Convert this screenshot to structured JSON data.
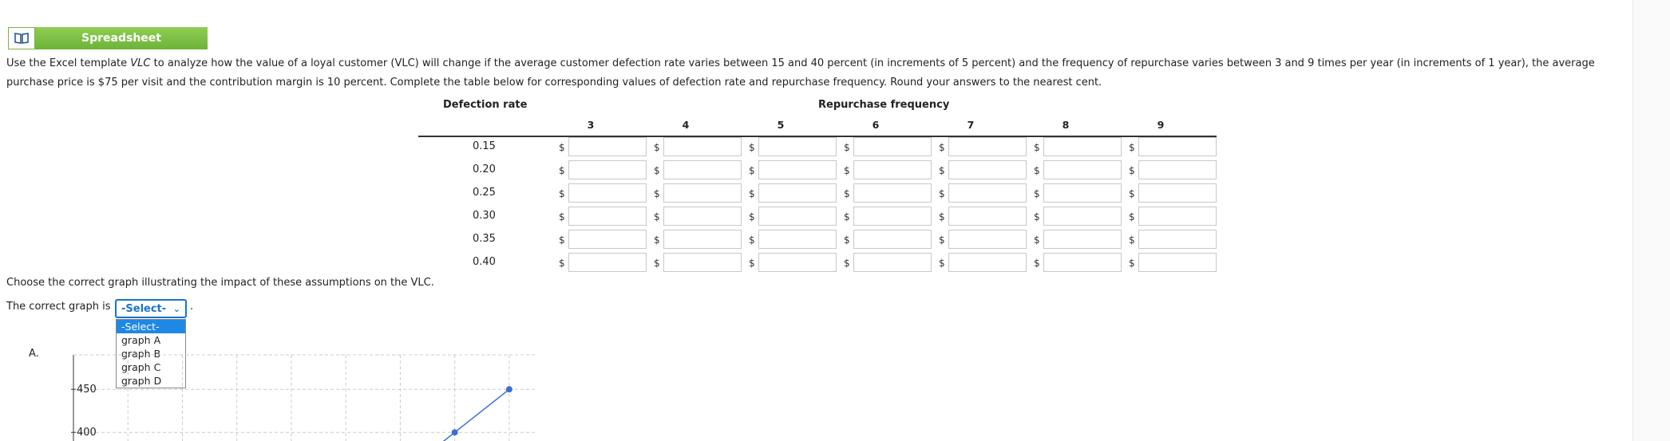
{
  "spreadsheet_button": {
    "label": "Spreadsheet",
    "icon": "book-icon"
  },
  "instructions": {
    "part1": "Use the Excel template ",
    "template_name": "VLC",
    "part2": " to analyze how the value of a loyal customer (VLC) will change if the average customer defection rate varies between 15 and 40 percent (in increments of 5 percent) and the frequency of repurchase varies between 3 and 9 times per year (in increments of 1 year), the average purchase price is $75 per visit and the contribution margin is 10 percent. Complete the table below for corresponding values of defection rate and repurchase frequency. Round your answers to the nearest cent."
  },
  "table": {
    "row_header": "Defection rate",
    "col_header": "Repurchase frequency",
    "columns": [
      "3",
      "4",
      "5",
      "6",
      "7",
      "8",
      "9"
    ],
    "rows": [
      "0.15",
      "0.20",
      "0.25",
      "0.30",
      "0.35",
      "0.40"
    ],
    "currency": "$"
  },
  "question": {
    "prompt": "Choose the correct graph illustrating the impact of these assumptions on the VLC.",
    "lead": "The correct graph is",
    "selected": "-Select-",
    "options": [
      "-Select-",
      "graph A",
      "graph B",
      "graph C",
      "graph D"
    ],
    "period": "."
  },
  "graph_a": {
    "label": "A.",
    "tick_labels": [
      "450",
      "400"
    ]
  },
  "chart_data": {
    "type": "line",
    "title": "",
    "ytick_labels": [
      "450",
      "400"
    ],
    "series": [
      {
        "points": [
          {
            "x": 7,
            "y": 400
          },
          {
            "x": 8,
            "y": 450
          }
        ]
      }
    ],
    "xlim": [
      0,
      8.5
    ],
    "ylim": [
      390,
      490
    ],
    "grid": true
  }
}
